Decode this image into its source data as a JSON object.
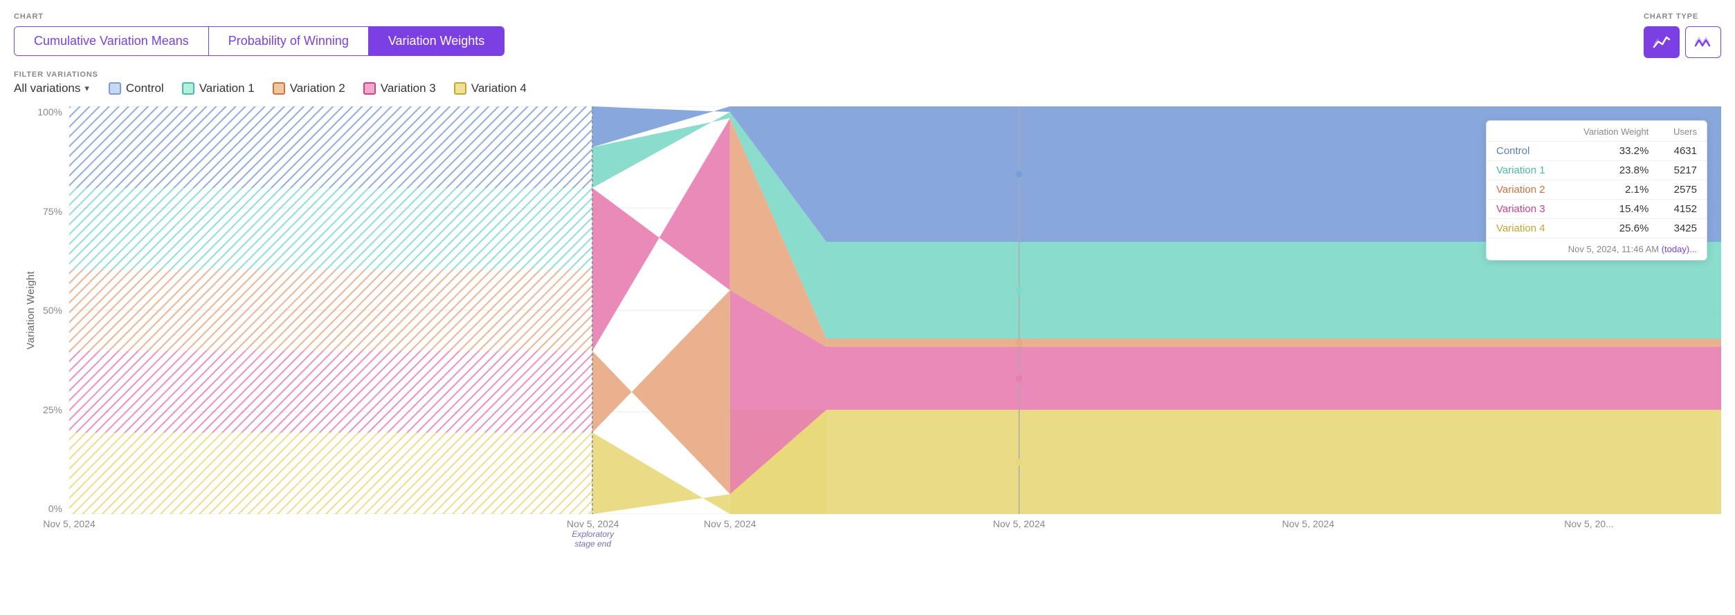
{
  "header": {
    "chart_label": "CHART",
    "chart_type_label": "CHART TYPE"
  },
  "tabs": [
    {
      "id": "cumulative",
      "label": "Cumulative Variation Means",
      "active": false
    },
    {
      "id": "probability",
      "label": "Probability of Winning",
      "active": false
    },
    {
      "id": "weights",
      "label": "Variation Weights",
      "active": true
    }
  ],
  "chart_type_buttons": [
    {
      "id": "line",
      "icon": "📈",
      "active": true
    },
    {
      "id": "zigzag",
      "icon": "〰",
      "active": false
    }
  ],
  "filter": {
    "label": "FILTER VARIATIONS",
    "dropdown_label": "All variations"
  },
  "variations": [
    {
      "id": "control",
      "label": "Control",
      "color": "#7b9ed9",
      "border_color": "#5a7fc0"
    },
    {
      "id": "variation1",
      "label": "Variation 1",
      "color": "#7dd9c8",
      "border_color": "#4db9a5"
    },
    {
      "id": "variation2",
      "label": "Variation 2",
      "color": "#e8a882",
      "border_color": "#d07040"
    },
    {
      "id": "variation3",
      "label": "Variation 3",
      "color": "#e87db0",
      "border_color": "#d04085"
    },
    {
      "id": "variation4",
      "label": "Variation 4",
      "color": "#e8d87a",
      "border_color": "#c0a830"
    }
  ],
  "y_axis": {
    "label": "Variation Weight",
    "ticks": [
      "100%",
      "75%",
      "50%",
      "25%",
      "0%"
    ]
  },
  "x_axis": {
    "ticks": [
      {
        "label": "Nov 5, 2024",
        "sub": ""
      },
      {
        "label": "Nov 5, 2024",
        "sub": "Exploratory\nstage end"
      },
      {
        "label": "Nov 5, 2024",
        "sub": ""
      },
      {
        "label": "Nov 5, 2024",
        "sub": ""
      },
      {
        "label": "Nov 5, 2024",
        "sub": ""
      },
      {
        "label": "Nov 5, 20...",
        "sub": ""
      }
    ]
  },
  "tooltip": {
    "headers": [
      "",
      "Variation Weight",
      "Users"
    ],
    "rows": [
      {
        "name": "Control",
        "color": "#7b9ed9",
        "weight": "33.2%",
        "users": "4631"
      },
      {
        "name": "Variation 1",
        "color": "#7dd9c8",
        "weight": "23.8%",
        "users": "5217"
      },
      {
        "name": "Variation 2",
        "color": "#e8a882",
        "weight": "2.1%",
        "users": "2575"
      },
      {
        "name": "Variation 3",
        "color": "#e87db0",
        "weight": "15.4%",
        "users": "4152"
      },
      {
        "name": "Variation 4",
        "color": "#e8d87a",
        "weight": "25.6%",
        "users": "3425"
      }
    ],
    "footer": "Nov 5, 2024, 11:46 AM",
    "footer_suffix": "(today)..."
  }
}
